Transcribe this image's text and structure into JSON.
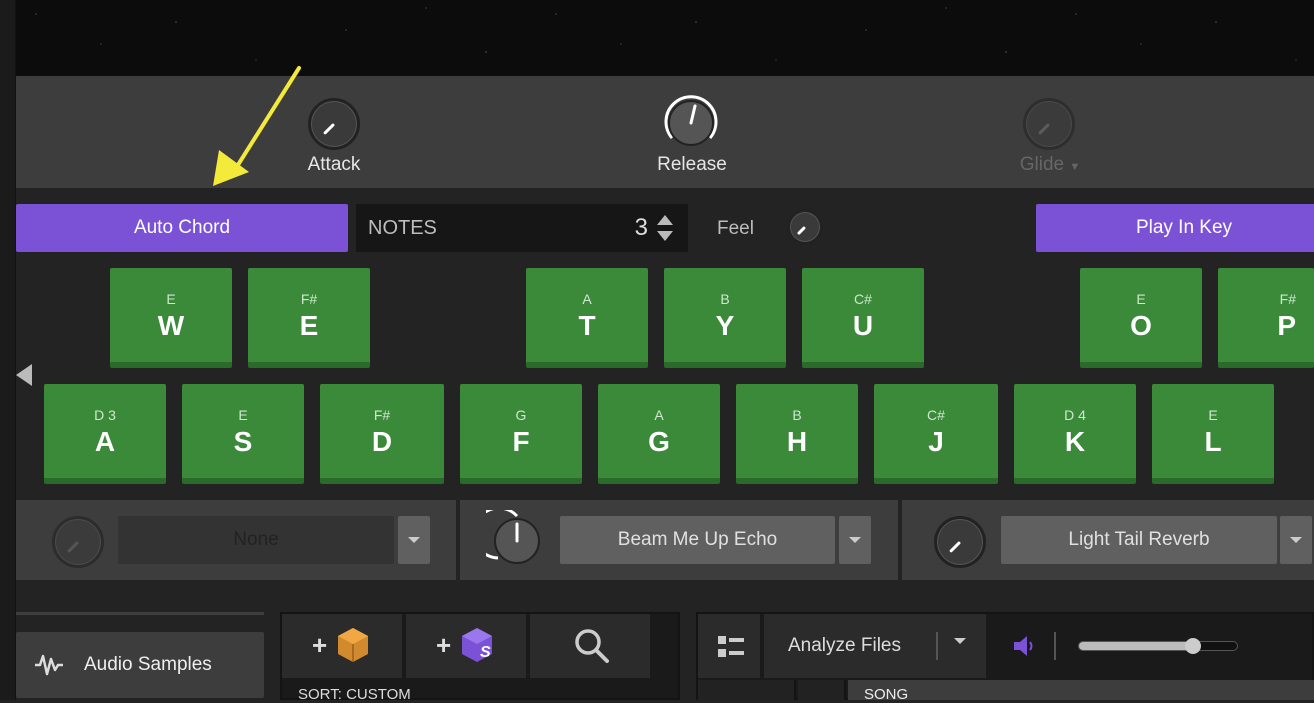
{
  "knobs": {
    "attack": "Attack",
    "release": "Release",
    "glide": "Glide"
  },
  "chord": {
    "auto_chord": "Auto Chord",
    "notes_label": "NOTES",
    "notes_value": "3",
    "feel_label": "Feel",
    "play_in_key": "Play In Key"
  },
  "keys_top": [
    {
      "note": "E",
      "letter": "W"
    },
    {
      "note": "F#",
      "letter": "E"
    },
    {
      "note": "A",
      "letter": "T"
    },
    {
      "note": "B",
      "letter": "Y"
    },
    {
      "note": "C#",
      "letter": "U"
    },
    {
      "note": "E",
      "letter": "O"
    },
    {
      "note": "F#",
      "letter": "P"
    }
  ],
  "keys_bottom": [
    {
      "note": "D 3",
      "letter": "A"
    },
    {
      "note": "E",
      "letter": "S"
    },
    {
      "note": "F#",
      "letter": "D"
    },
    {
      "note": "G",
      "letter": "F"
    },
    {
      "note": "A",
      "letter": "G"
    },
    {
      "note": "B",
      "letter": "H"
    },
    {
      "note": "C#",
      "letter": "J"
    },
    {
      "note": "D 4",
      "letter": "K"
    },
    {
      "note": "E",
      "letter": "L"
    }
  ],
  "effects": [
    "None",
    "Beam Me Up Echo",
    "Light Tail Reverb"
  ],
  "bottom": {
    "audio_samples": "Audio Samples",
    "sort_label": "SORT: CUSTOM",
    "analyze_files": "Analyze Files",
    "song_header": "SONG",
    "add_s": "S"
  },
  "colors": {
    "accent": "#7b52d6",
    "key_green": "#3a8a3a",
    "arrow_yellow": "#f3ea3a"
  }
}
